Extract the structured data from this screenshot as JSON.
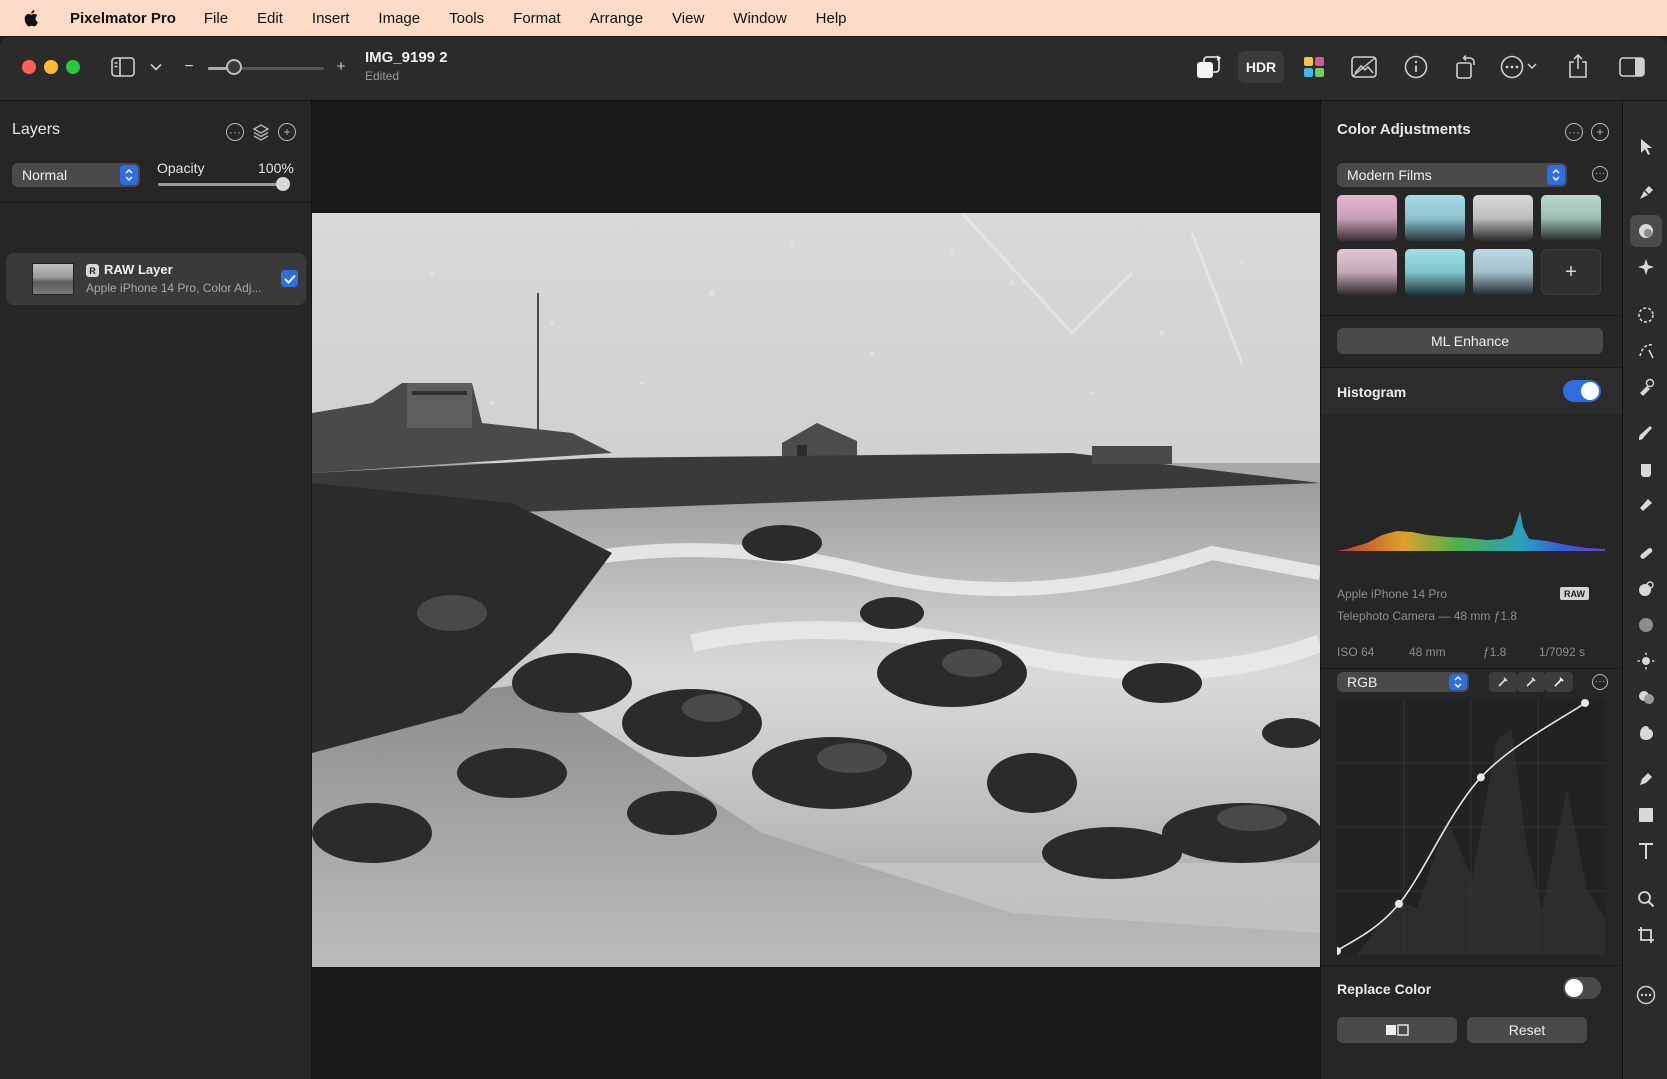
{
  "menubar": {
    "app_name": "Pixelmator Pro",
    "items": [
      "File",
      "Edit",
      "Insert",
      "Image",
      "Tools",
      "Format",
      "Arrange",
      "View",
      "Window",
      "Help"
    ]
  },
  "document": {
    "title": "IMG_9199 2",
    "status": "Edited"
  },
  "toolbar": {
    "zoom_fraction": 0.22,
    "hdr_label": "HDR"
  },
  "layers": {
    "title": "Layers",
    "blend_mode": "Normal",
    "opacity_label": "Opacity",
    "opacity_value": "100%",
    "opacity_fraction": 1.0,
    "items": [
      {
        "name": "RAW Layer",
        "badge": "R",
        "subtitle": "Apple iPhone 14 Pro, Color Adj...",
        "visible": true
      }
    ]
  },
  "adjustments": {
    "title": "Color Adjustments",
    "preset_category": "Modern Films",
    "preset_add_label": "+",
    "ml_enhance_label": "ML Enhance",
    "histogram": {
      "label": "Histogram",
      "enabled": true,
      "camera": "Apple iPhone 14 Pro",
      "raw_badge": "RAW",
      "lens": "Telephoto Camera — 48 mm ƒ1.8",
      "exif": [
        "ISO 64",
        "48 mm",
        "ƒ1.8",
        "1/7092 s"
      ]
    },
    "curves": {
      "channel": "RGB",
      "points": [
        [
          0,
          0
        ],
        [
          0.25,
          0.19
        ],
        [
          0.58,
          0.7
        ],
        [
          1,
          1
        ]
      ]
    },
    "replace_color": {
      "label": "Replace Color",
      "enabled": false
    },
    "reset_label": "Reset",
    "compare_label": "◧"
  },
  "colors": {
    "accent": "#2f6ee0",
    "menubar": "#fcdcc6"
  }
}
